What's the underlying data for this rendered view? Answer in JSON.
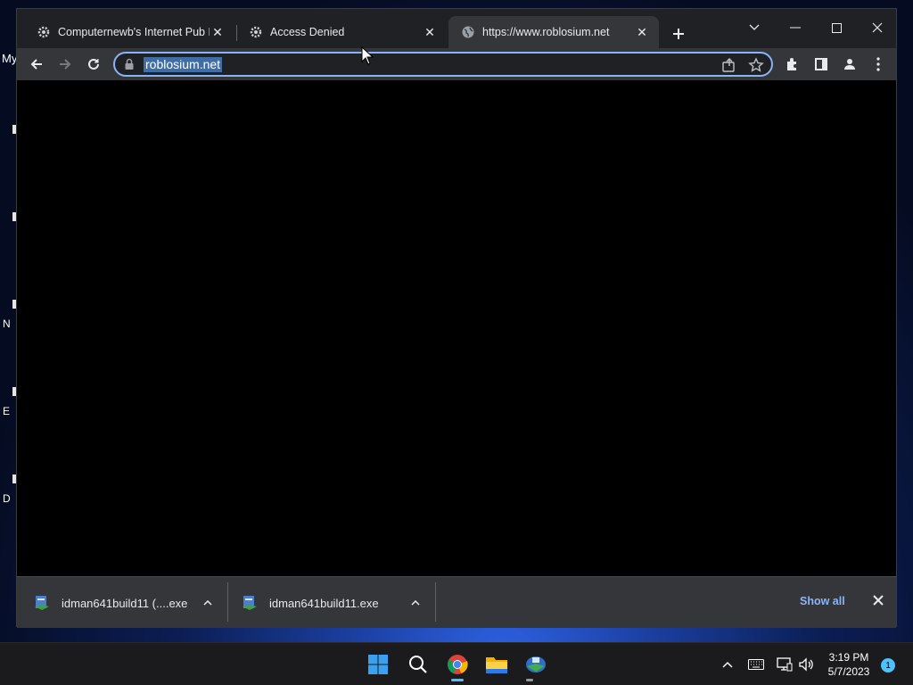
{
  "desktop": {
    "top_label": "My",
    "icon_fragments": [
      "",
      "",
      "N",
      "E",
      "D"
    ]
  },
  "browser": {
    "tabs": [
      {
        "title": "Computernewb's Internet Pub H",
        "favicon": "gear-favicon-icon",
        "active": false
      },
      {
        "title": "Access Denied",
        "favicon": "gear-favicon-icon",
        "active": false
      },
      {
        "title": "https://www.roblosium.net",
        "favicon": "globe-icon",
        "active": true
      }
    ],
    "omnibox": {
      "url": "roblosium.net",
      "secure": true
    },
    "downloads": {
      "items": [
        {
          "name": "idman641build11 (....exe"
        },
        {
          "name": "idman641build11.exe"
        }
      ],
      "show_all_label": "Show all"
    },
    "colors": {
      "accent": "#8ab4f8",
      "frame": "#202124",
      "toolbar": "#35363a",
      "url_highlight": "#3f6ea7"
    }
  },
  "taskbar": {
    "apps": [
      "windows-start-icon",
      "search-icon",
      "chrome-icon",
      "file-explorer-icon",
      "internet-download-manager-icon"
    ],
    "clock": {
      "time": "3:19 PM",
      "date": "5/7/2023"
    },
    "notification_count": "1"
  }
}
